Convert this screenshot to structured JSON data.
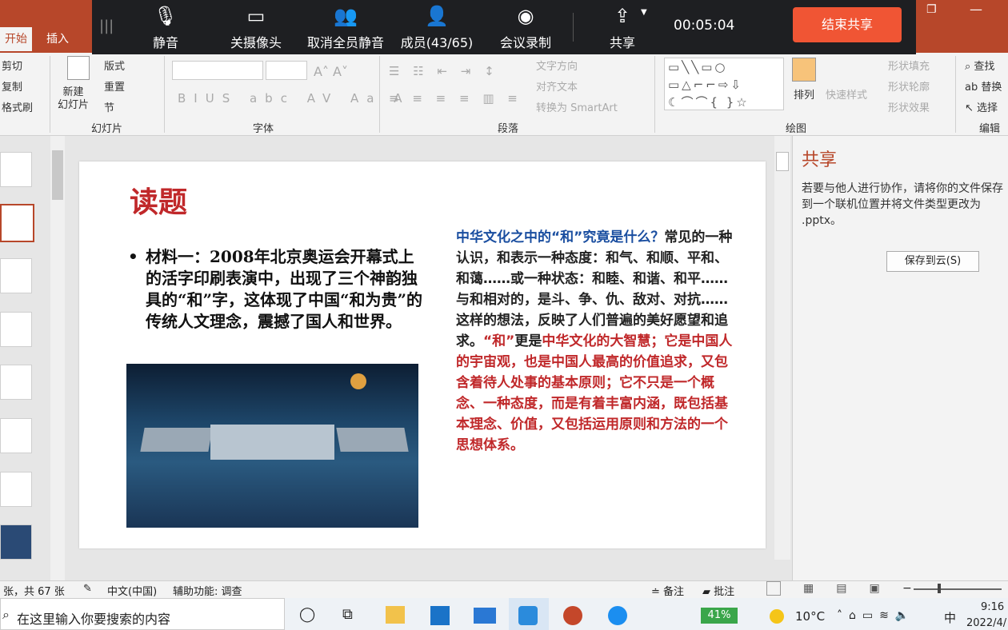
{
  "ribbon": {
    "tab_home": "开始",
    "tab_insert": "插入",
    "cut": "剪切",
    "copy": "复制",
    "format_painter": "格式刷",
    "new_slide": "新建\n幻灯片",
    "layout": "版式",
    "reset": "重置",
    "section": "节",
    "grp_slides": "幻灯片",
    "grp_font": "字体",
    "grp_paragraph": "段落",
    "grp_drawing": "绘图",
    "grp_edit": "编辑",
    "text_direction": "文字方向",
    "align_text": "对齐文本",
    "smartart": "转换为 SmartArt",
    "arrange": "排列",
    "quick_styles": "快速样式",
    "shape_fill": "形状填充",
    "shape_outline": "形状轮廓",
    "shape_effects": "形状效果",
    "find": "查找",
    "replace": "替换",
    "select": "选择"
  },
  "meeting": {
    "mute": "静音",
    "camera_off": "关摄像头",
    "unmute_all": "取消全员静音",
    "members": "成员(43/65)",
    "record": "会议录制",
    "share": "共享",
    "timer": "00:05:04",
    "end_share": "结束共享"
  },
  "slide": {
    "title": "读题",
    "bullet": "材料一：2008年北京奥运会开幕式上的活字印刷表演中，出现了三个神韵独具的“和”字，这体现了中国“和为贵”的传统人文理念，震撼了国人和世界。",
    "question": "中华文化之中的“和”究竟是什么？",
    "body_black": "常见的一种认识，和表示一种态度：和气、和顺、平和、和蔼……或一种状态：和睦、和谐、和平……与和相对的，是斗、争、仇、敌对、对抗……这样的想法，反映了人们普遍的美好愿望和追求。",
    "body_quote": "“和”",
    "body_black2": "更是",
    "body_red": "中华文化的大智慧；它是中国人的宇宙观，也是中国人最高的价值追求，又包含着待人处事的基本原则；它不只是一个概念、一种态度，而是有着丰富内涵，既包括基本理念、价值，又包括运用原则和方法的一个思想体系。"
  },
  "share_panel": {
    "title": "共享",
    "text": "若要与他人进行协作，请将你的文件保存到一个联机位置并将文件类型更改为 .pptx。",
    "save_btn": "保存到云(S)"
  },
  "status": {
    "slide_count": "张，共 67 张",
    "language": "中文(中国)",
    "accessibility": "辅助功能: 调查",
    "notes": "备注",
    "comments": "批注"
  },
  "taskbar": {
    "search_placeholder": "在这里输入你要搜索的内容",
    "battery": "41%",
    "weather": "10°C",
    "ime": "中",
    "time": "9:16",
    "date": "2022/4/"
  },
  "colors": {
    "ppt_red": "#b7472a",
    "end_share": "#f05534",
    "slide_title": "#c0282a",
    "question_blue": "#1a4ea0"
  }
}
